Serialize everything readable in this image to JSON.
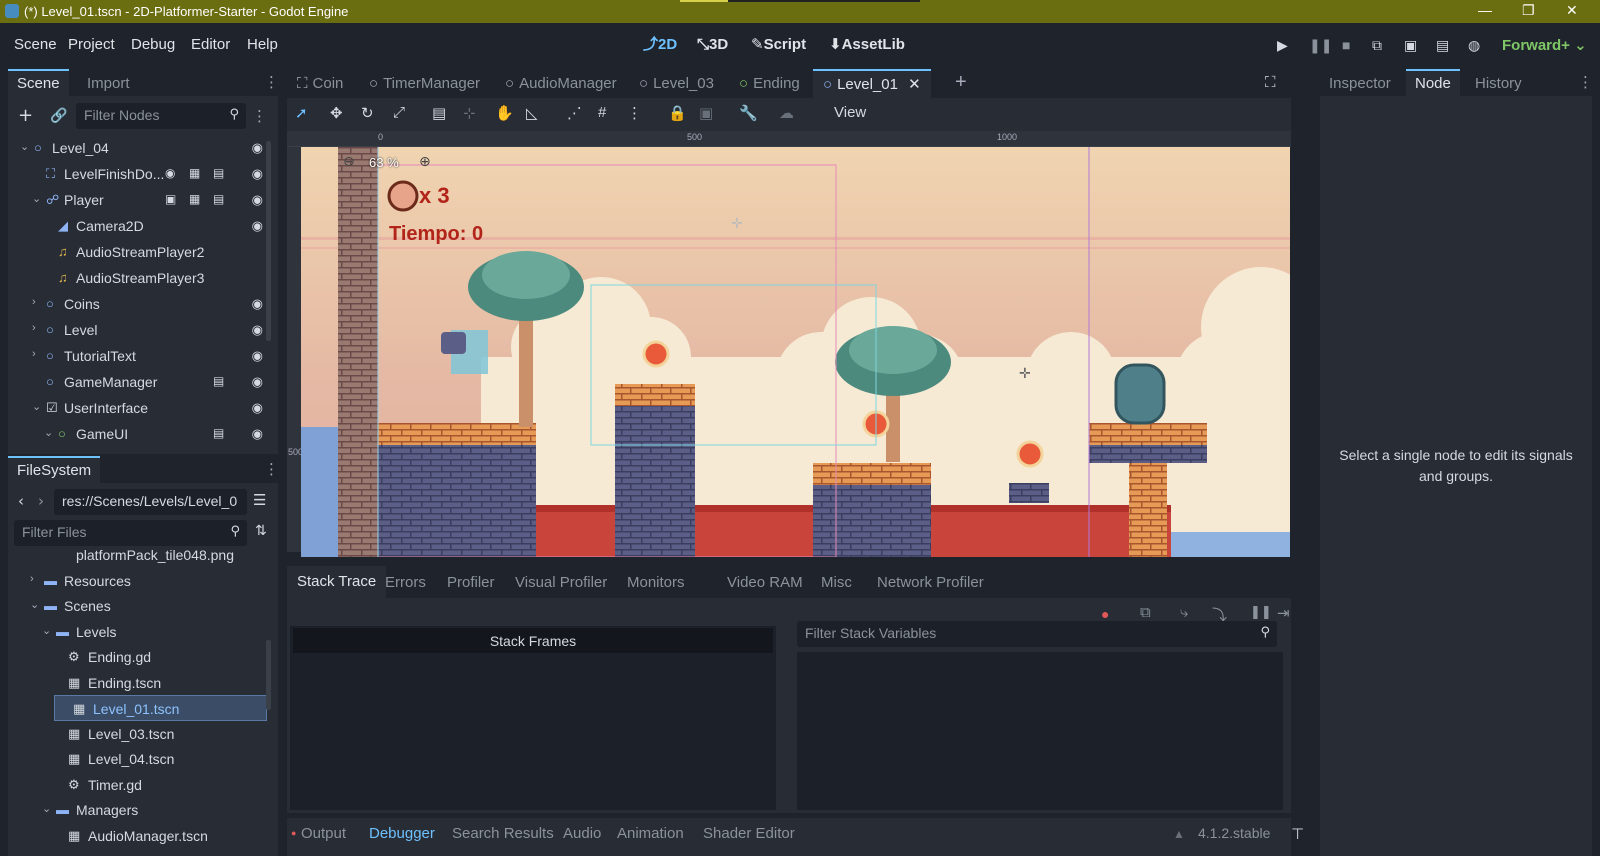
{
  "window": {
    "title": "(*) Level_01.tscn - 2D-Platformer-Starter - Godot Engine",
    "minimize": "—",
    "maximize": "❐",
    "close": "✕"
  },
  "menus": [
    "Scene",
    "Project",
    "Debug",
    "Editor",
    "Help"
  ],
  "modes": [
    {
      "icon": "⤴",
      "label": "2D",
      "active": true
    },
    {
      "icon": "⤡",
      "label": "3D",
      "active": false
    },
    {
      "icon": "✎",
      "label": "Script",
      "active": false
    },
    {
      "icon": "⬇",
      "label": "AssetLib",
      "active": false
    }
  ],
  "run_buttons": [
    "play-icon",
    "pause-icon",
    "stop-icon",
    "remote-debug-icon",
    "play-scene-icon",
    "play-custom-scene-icon",
    "movie-maker-icon"
  ],
  "renderer": "Forward+",
  "scene_dock": {
    "tabs": [
      "Scene",
      "Import"
    ],
    "filter_placeholder": "Filter Nodes",
    "nodes": [
      {
        "label": "Level_04",
        "indent": 0,
        "arrow": "⌄",
        "icon": "○",
        "color": "#8eb4f5",
        "extras": [],
        "eye": true
      },
      {
        "label": "LevelFinishDo...",
        "indent": 1,
        "arrow": "",
        "icon": "⛶",
        "color": "#8eb4f5",
        "extras": [
          "◉",
          "▦",
          "▤"
        ],
        "eye": true
      },
      {
        "label": "Player",
        "indent": 1,
        "arrow": "⌄",
        "icon": "☍",
        "color": "#8eb4f5",
        "extras": [
          "▣",
          "▦",
          "▤"
        ],
        "eye": true
      },
      {
        "label": "Camera2D",
        "indent": 2,
        "arrow": "",
        "icon": "◢",
        "color": "#8eb4f5",
        "extras": [],
        "eye": true
      },
      {
        "label": "AudioStreamPlayer2",
        "indent": 2,
        "arrow": "",
        "icon": "♫",
        "color": "#e0b34c",
        "extras": [],
        "eye": false
      },
      {
        "label": "AudioStreamPlayer3",
        "indent": 2,
        "arrow": "",
        "icon": "♫",
        "color": "#e0b34c",
        "extras": [],
        "eye": false
      },
      {
        "label": "Coins",
        "indent": 1,
        "arrow": "›",
        "icon": "○",
        "color": "#8eb4f5",
        "extras": [],
        "eye": true
      },
      {
        "label": "Level",
        "indent": 1,
        "arrow": "›",
        "icon": "○",
        "color": "#8eb4f5",
        "extras": [],
        "eye": true
      },
      {
        "label": "TutorialText",
        "indent": 1,
        "arrow": "›",
        "icon": "○",
        "color": "#8eb4f5",
        "extras": [],
        "eye": true
      },
      {
        "label": "GameManager",
        "indent": 1,
        "arrow": "",
        "icon": "○",
        "color": "#8eb4f5",
        "extras": [
          "▤"
        ],
        "eye": true
      },
      {
        "label": "UserInterface",
        "indent": 1,
        "arrow": "⌄",
        "icon": "☑",
        "color": "#d6dae0",
        "extras": [],
        "eye": true
      },
      {
        "label": "GameUI",
        "indent": 2,
        "arrow": "⌄",
        "icon": "○",
        "color": "#7fc766",
        "extras": [
          "▤"
        ],
        "eye": true
      }
    ]
  },
  "filesystem": {
    "title": "FileSystem",
    "path": "res://Scenes/Levels/Level_0",
    "filter_placeholder": "Filter Files",
    "items": [
      {
        "label": "platformPack_tile048.png",
        "indent": 2,
        "arrow": "",
        "icon": "",
        "selected": false
      },
      {
        "label": "Resources",
        "indent": 1,
        "arrow": "›",
        "icon": "▬",
        "selected": false
      },
      {
        "label": "Scenes",
        "indent": 1,
        "arrow": "⌄",
        "icon": "▬",
        "selected": false
      },
      {
        "label": "Levels",
        "indent": 2,
        "arrow": "⌄",
        "icon": "▬",
        "selected": false
      },
      {
        "label": "Ending.gd",
        "indent": 3,
        "arrow": "",
        "icon": "⚙",
        "selected": false
      },
      {
        "label": "Ending.tscn",
        "indent": 3,
        "arrow": "",
        "icon": "▦",
        "selected": false
      },
      {
        "label": "Level_01.tscn",
        "indent": 3,
        "arrow": "",
        "icon": "▦",
        "selected": true
      },
      {
        "label": "Level_03.tscn",
        "indent": 3,
        "arrow": "",
        "icon": "▦",
        "selected": false
      },
      {
        "label": "Level_04.tscn",
        "indent": 3,
        "arrow": "",
        "icon": "▦",
        "selected": false
      },
      {
        "label": "Timer.gd",
        "indent": 3,
        "arrow": "",
        "icon": "⚙",
        "selected": false
      },
      {
        "label": "Managers",
        "indent": 2,
        "arrow": "⌄",
        "icon": "▬",
        "selected": false
      },
      {
        "label": "AudioManager.tscn",
        "indent": 3,
        "arrow": "",
        "icon": "▦",
        "selected": false
      }
    ]
  },
  "scene_tabs": [
    {
      "label": "Coin",
      "icon": "⛶",
      "active": false
    },
    {
      "label": "TimerManager",
      "icon": "○",
      "active": false
    },
    {
      "label": "AudioManager",
      "icon": "○",
      "active": false
    },
    {
      "label": "Level_03",
      "icon": "○",
      "active": false
    },
    {
      "label": "Ending",
      "icon": "○",
      "active": false
    },
    {
      "label": "Level_01",
      "icon": "○",
      "active": true
    }
  ],
  "toolbar": {
    "view_label": "View",
    "zoom_text": "63 %"
  },
  "ruler": {
    "marks": [
      "0",
      "500",
      "1000"
    ],
    "vmark": "500"
  },
  "game_hud": {
    "coins_text": "x 3",
    "timer_text": "Tiempo: 0"
  },
  "inspector": {
    "tabs": [
      "Inspector",
      "Node",
      "History"
    ],
    "message": "Select a single node to edit its signals and groups."
  },
  "debugger": {
    "tabs": [
      "Stack Trace",
      "Errors",
      "Profiler",
      "Visual Profiler",
      "Monitors",
      "Video RAM",
      "Misc",
      "Network Profiler"
    ],
    "stack_frames_header": "Stack Frames",
    "filter_placeholder": "Filter Stack Variables"
  },
  "bottom_bar": {
    "buttons": [
      {
        "label": "Output",
        "active": false
      },
      {
        "label": "Debugger",
        "active": true
      },
      {
        "label": "Search Results",
        "active": false
      },
      {
        "label": "Audio",
        "active": false
      },
      {
        "label": "Animation",
        "active": false
      },
      {
        "label": "Shader Editor",
        "active": false
      }
    ],
    "version": "4.1.2.stable"
  }
}
